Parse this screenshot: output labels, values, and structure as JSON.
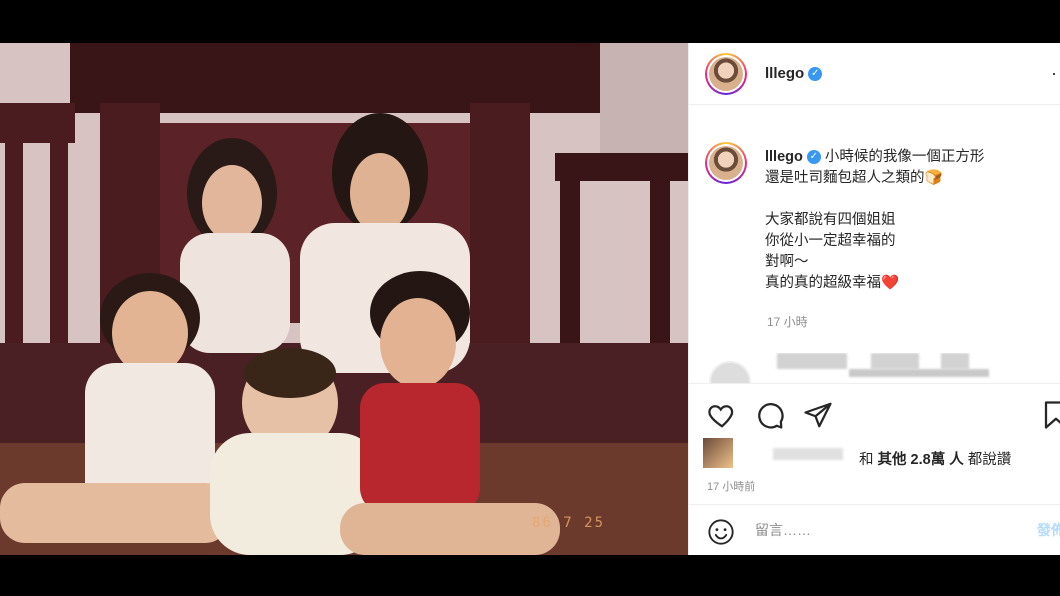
{
  "post": {
    "username": "lllego",
    "verified_icon": "verified-badge-icon",
    "more_label": "···",
    "photo_date_stamp": "86 7 25"
  },
  "caption": {
    "username": "lllego",
    "lines": [
      "小時候的我像一個正方形",
      "還是吐司麵包超人之類的🍞",
      "",
      "大家都說有四個姐姐",
      "你從小一定超幸福的",
      "對啊～",
      "真的真的超級幸福❤️"
    ],
    "time_ago": "17 小時"
  },
  "actions": {
    "icons": [
      "heart-icon",
      "comment-icon",
      "share-icon",
      "bookmark-icon"
    ]
  },
  "likes": {
    "prefix": "和",
    "count_label": "其他 2.8萬 人",
    "suffix": "都說讚",
    "time": "17 小時前"
  },
  "comment": {
    "placeholder": "留言……",
    "post_label": "發佈",
    "emoji_icon": "emoji-icon"
  },
  "colors": {
    "accent": "#3897f0",
    "text": "#262626",
    "muted": "#8e8e8e",
    "heart": "#ed4956"
  }
}
